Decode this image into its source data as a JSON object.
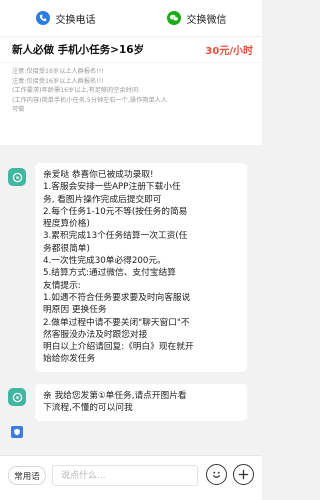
{
  "topbar": {
    "phone_label": "交换电话",
    "phone_icon": "phone-icon",
    "wechat_label": "交换微信",
    "wechat_icon": "wechat-icon"
  },
  "job": {
    "title": "新人必做 手机小任务>16岁",
    "salary": "30元/小时"
  },
  "notice": {
    "lines": [
      "注意:仅接受16岁以上人群报名!!!",
      "注意:仅接受16岁以上人群报名!!!",
      "(工作要求)年龄需16岁以上,有足够的空余时间:",
      "(工作内容)简单手机小任务,5分钟左右一个,操作简单人人",
      "可做"
    ]
  },
  "messages": [
    {
      "lines": [
        "亲爱哒 恭喜你已被成功录取!",
        "1.客服会安排一些APP注册下载小任",
        "务, 看图片操作完成后提交即可",
        "2.每个任务1-10元不等(按任务的简易",
        "程度算价格)",
        "3.累积完成13个任务结算一次工资(任",
        "务都很简单)",
        "4.一次性完成30单必得200元。",
        "5.结算方式:通过微信、支付宝结算",
        "友情提示:",
        "1.如遇不符合任务要求要及时向客服说",
        "明原因 更换任务",
        "2.做单过程中请不要关闭\"聊天窗口\"不",
        "然客服没办法及时跟您对接",
        "明白以上介绍请回复:《明白》现在就开",
        "始给你发任务"
      ]
    },
    {
      "lines": [
        "亲 我给您发第①单任务,请点开图片看",
        "下流程,不懂的可以问我"
      ]
    }
  ],
  "bottom": {
    "quick_phrases": "常用语",
    "input_placeholder": "说点什么...",
    "emoji_icon": "emoji-icon",
    "plus_icon": "plus-icon"
  },
  "colors": {
    "accent_blue": "#2a7de1",
    "wechat_green": "#1aad19",
    "salary_red": "#e8503a",
    "avatar_teal": "#41b6a2"
  }
}
